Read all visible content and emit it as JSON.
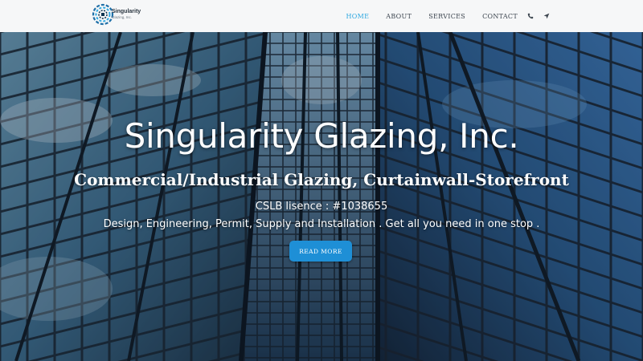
{
  "header": {
    "logo_title": "Singularity",
    "logo_subtitle": "Glazing, Inc.",
    "nav": {
      "home": "HOME",
      "about": "ABOUT",
      "services": "SERVICES",
      "contact": "CONTACT"
    },
    "icons": [
      "phone-icon",
      "location-arrow-icon"
    ],
    "active_color": "#2fa8e0"
  },
  "hero": {
    "title": "Singularity Glazing, Inc.",
    "subtitle": "Commercial/Industrial Glazing, Curtainwall-Storefront",
    "license": "CSLB lisence : #1038655",
    "description": "Design, Engineering, Permit, Supply and Installation . Get all you need in one stop .",
    "button_label": "READ MORE",
    "button_color": "#1e8fd6"
  }
}
